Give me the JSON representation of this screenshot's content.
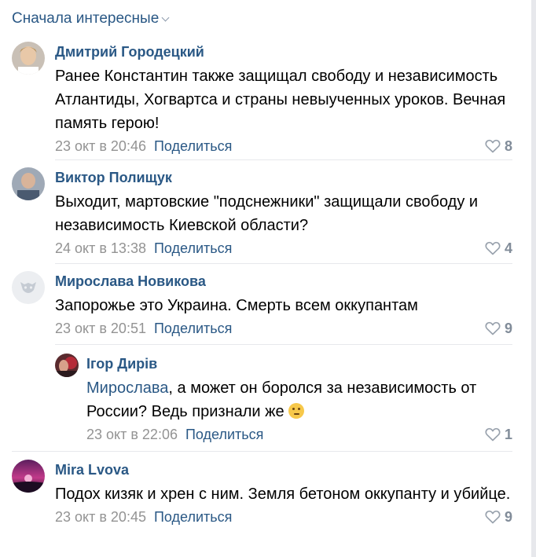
{
  "sort": {
    "label": "Сначала интересные"
  },
  "comments": [
    {
      "author": "Дмитрий Городецкий",
      "text": "Ранее Константин также защищал свободу и независимость Атлантиды, Хогвартса и страны невыученных уроков. Вечная память герою!",
      "date": "23 окт в 20:46",
      "share": "Поделиться",
      "likes": "8"
    },
    {
      "author": "Виктор Полищук",
      "text": "Выходит, мартовские \"подснежники\" защищали свободу и независимость Киевской области?",
      "date": "24 окт в 13:38",
      "share": "Поделиться",
      "likes": "4"
    },
    {
      "author": "Мирослава Новикова",
      "text": "Запорожье это Украина. Смерть всем оккупантам",
      "date": "23 окт в 20:51",
      "share": "Поделиться",
      "likes": "9"
    },
    {
      "author": "Mira Lvova",
      "text": "Подох кизяк и хрен с ним. Земля бетоном оккупанту и убийце.",
      "date": "23 окт в 20:45",
      "share": "Поделиться",
      "likes": "9"
    }
  ],
  "reply": {
    "author": "Ігор Дирів",
    "mention": "Мирослава",
    "text": ", а может он боролся за независимость от России? Ведь признали же",
    "emoji": "thinking-face",
    "date": "23 окт в 22:06",
    "share": "Поделиться",
    "likes": "1"
  },
  "colors": {
    "link": "#2a5885",
    "meta": "#939393",
    "like_count": "#818c99",
    "separator": "#e7e8ec"
  }
}
